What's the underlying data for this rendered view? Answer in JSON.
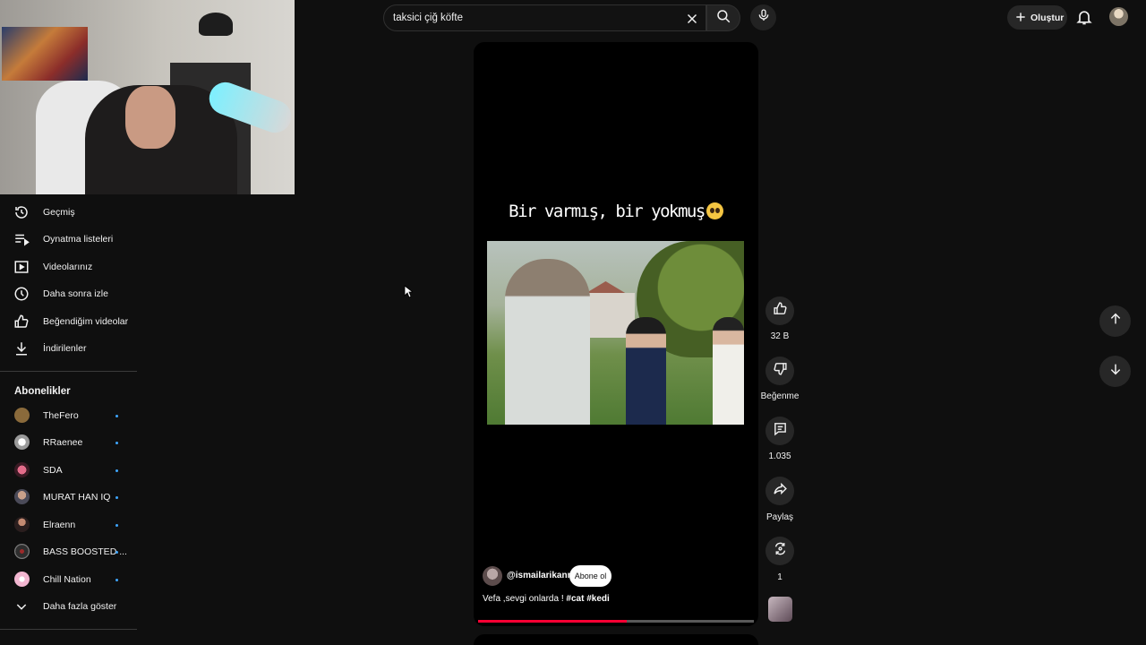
{
  "search": {
    "value": "taksici çiğ köfte"
  },
  "header": {
    "create_label": "Oluştur"
  },
  "sidebar": {
    "items": [
      {
        "label": "Geçmiş",
        "icon": "history-icon"
      },
      {
        "label": "Oynatma listeleri",
        "icon": "playlists-icon"
      },
      {
        "label": "Videolarınız",
        "icon": "your-videos-icon"
      },
      {
        "label": "Daha sonra izle",
        "icon": "watch-later-icon"
      },
      {
        "label": "Beğendiğim videolar",
        "icon": "liked-icon"
      },
      {
        "label": "İndirilenler",
        "icon": "download-icon"
      }
    ],
    "subscriptions_title": "Abonelikler",
    "subscriptions": [
      {
        "name": "TheFero",
        "color": "#8a6a3b"
      },
      {
        "name": "RRaenee",
        "color": "#d8d8d8"
      },
      {
        "name": "SDA",
        "color": "#b0304a"
      },
      {
        "name": "MURAT HAN IQ",
        "color": "#6c6c7a"
      },
      {
        "name": "Elraenn",
        "color": "#3a2a2a"
      },
      {
        "name": "BASS BOOSTED ...",
        "color": "#4a4a4a"
      },
      {
        "name": "Chill Nation",
        "color": "#f2b6d0"
      }
    ],
    "show_more": "Daha fazla göster"
  },
  "short": {
    "caption": "Bir varmış, bir yokmuş",
    "channel": "@ismailarikann",
    "subscribe_label": "Abone ol",
    "description": "Vefa ,sevgi onlarda ! ",
    "hashtags": "#cat #kedi",
    "progress": 0.54
  },
  "actions": {
    "likes": "32 B",
    "dislike": "Beğenme",
    "comments": "1.035",
    "share": "Paylaş",
    "remix": "1"
  },
  "colors": {
    "accent": "#ff0033",
    "link": "#3ea6ff"
  }
}
